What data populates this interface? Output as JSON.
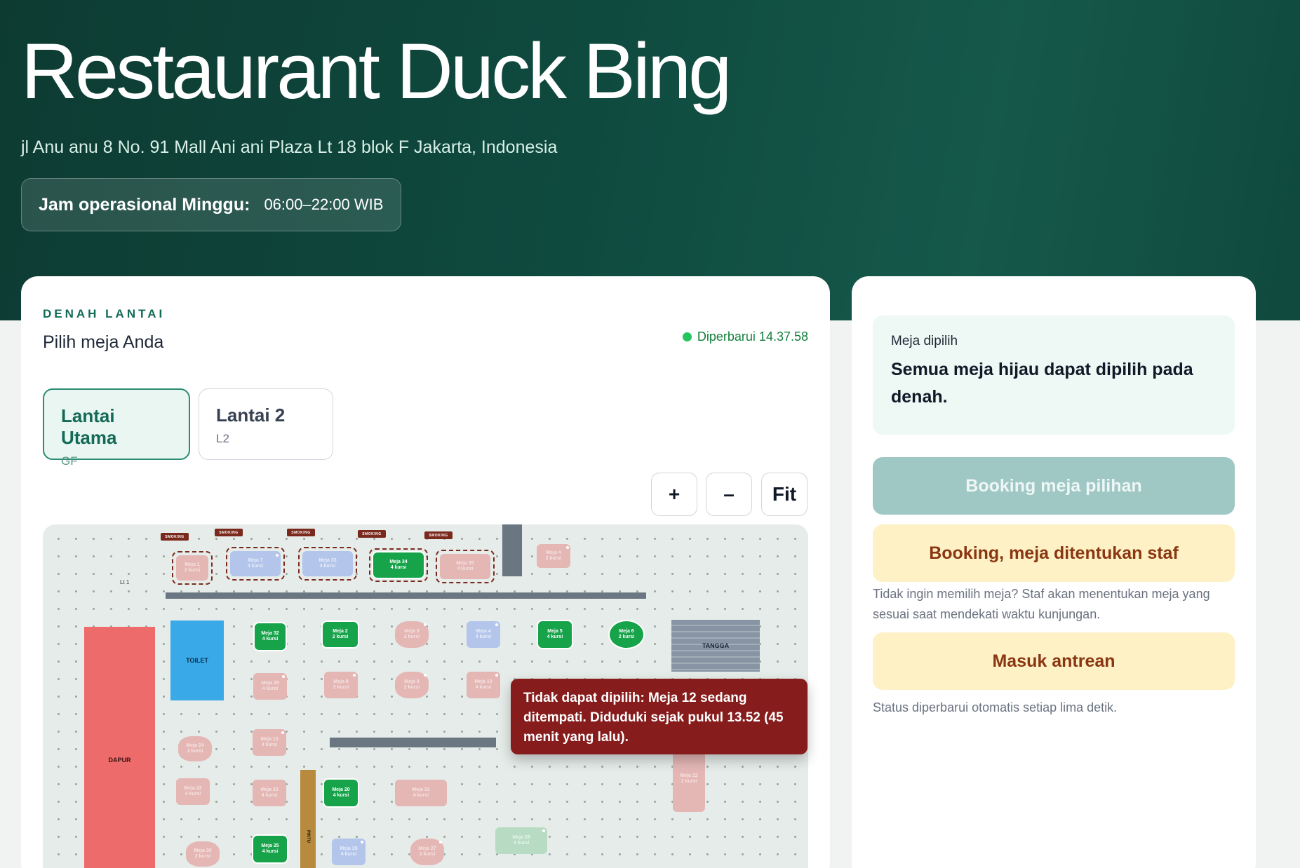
{
  "restaurant": {
    "name": "Restaurant Duck Bing",
    "address": "jl Anu anu 8 No. 91 Mall Ani ani Plaza Lt 18 blok F Jakarta, Indonesia",
    "hours_label": "Jam operasional Minggu:",
    "hours_value": "06:00–22:00 WIB"
  },
  "floor_plan": {
    "eyebrow": "DENAH LANTAI",
    "subtitle": "Pilih meja Anda",
    "updated": "Diperbarui 14.37.58",
    "floors": [
      {
        "name": "Lantai Utama",
        "code": "GF",
        "active": true
      },
      {
        "name": "Lantai 2",
        "code": "L2",
        "active": false
      }
    ],
    "zoom": {
      "in": "+",
      "out": "–",
      "fit": "Fit"
    },
    "labels": {
      "lt1": "Lt 1",
      "toilet": "TOILET",
      "dapur": "DAPUR",
      "tangga": "TANGGA",
      "pintu": "PINTU",
      "smoking": "SMOKING"
    },
    "tables": [
      {
        "id": "t1",
        "text": "Meja 1\n2 kursi",
        "status": "pink"
      },
      {
        "id": "t7",
        "text": "Meja 7\n4 kursi",
        "status": "blue"
      },
      {
        "id": "t33",
        "text": "Meja 33\n4 kursi",
        "status": "blue"
      },
      {
        "id": "t34",
        "text": "Meja 34\n4 kursi",
        "status": "green"
      },
      {
        "id": "t35",
        "text": "Meja 35\n4 kursi",
        "status": "pink"
      },
      {
        "id": "t4",
        "text": "Meja 4\n2 kursi",
        "status": "pink"
      },
      {
        "id": "t32",
        "text": "Meja 32\n4 kursi",
        "status": "green"
      },
      {
        "id": "t2",
        "text": "Meja 2\n2 kursi",
        "status": "green"
      },
      {
        "id": "t3",
        "text": "Meja 3\n2 kursi",
        "status": "pink"
      },
      {
        "id": "t4b",
        "text": "Meja 4\n4 kursi",
        "status": "blue"
      },
      {
        "id": "t5",
        "text": "Meja 5\n4 kursi",
        "status": "green"
      },
      {
        "id": "t6",
        "text": "Meja 6\n2 kursi",
        "status": "green"
      },
      {
        "id": "t29",
        "text": "Meja 29\n4 kursi",
        "status": "pink"
      },
      {
        "id": "t8",
        "text": "Meja 8\n2 kursi",
        "status": "pink"
      },
      {
        "id": "t9",
        "text": "Meja 9\n2 kursi",
        "status": "pink"
      },
      {
        "id": "t10",
        "text": "Meja 10\n4 kursi",
        "status": "pink"
      },
      {
        "id": "t24",
        "text": "Meja 24\n2 kursi",
        "status": "pink"
      },
      {
        "id": "t13",
        "text": "Meja 13\n4 kursi",
        "status": "pink"
      },
      {
        "id": "t22",
        "text": "Meja 22\n4 kursi",
        "status": "pink"
      },
      {
        "id": "t23",
        "text": "Meja 23\n4 kursi",
        "status": "pink"
      },
      {
        "id": "t20",
        "text": "Meja 20\n4 kursi",
        "status": "green"
      },
      {
        "id": "t21",
        "text": "Meja 21\n4 kursi",
        "status": "pink"
      },
      {
        "id": "t12",
        "text": "Meja 12\n2 kursi",
        "status": "pink"
      },
      {
        "id": "t30",
        "text": "Meja 30\n2 kursi",
        "status": "pink"
      },
      {
        "id": "t25",
        "text": "Meja 25\n4 kursi",
        "status": "green"
      },
      {
        "id": "t26",
        "text": "Meja 26\n4 kursi",
        "status": "blue"
      },
      {
        "id": "t27",
        "text": "Meja 27\n2 kursi",
        "status": "pink"
      },
      {
        "id": "t28",
        "text": "Meja 28\n4 kursi",
        "status": "mint"
      }
    ],
    "tooltip": "Tidak dapat dipilih: Meja 12 sedang ditempati. Diduduki sejak pukul 13.52 (45 menit yang lalu)."
  },
  "sidebar": {
    "selected_label": "Meja dipilih",
    "selected_text": "Semua meja hijau dapat dipilih pada denah.",
    "book_selected": "Booking meja pilihan",
    "book_staff": "Booking, meja ditentukan staf",
    "staff_note": "Tidak ingin memilih meja? Staf akan menentukan meja yang sesuai saat mendekati waktu kunjungan.",
    "queue": "Masuk antrean",
    "auto_note": "Status diperbarui otomatis setiap lima detik."
  },
  "colors": {
    "hero": "#0f4a3f",
    "accent": "#136a56",
    "available": "#16a34a",
    "occupied": "#e4b7b5",
    "reserved": "#b3c5ea",
    "tooltip": "#871c1c",
    "yellow": "#fdf1c5"
  }
}
